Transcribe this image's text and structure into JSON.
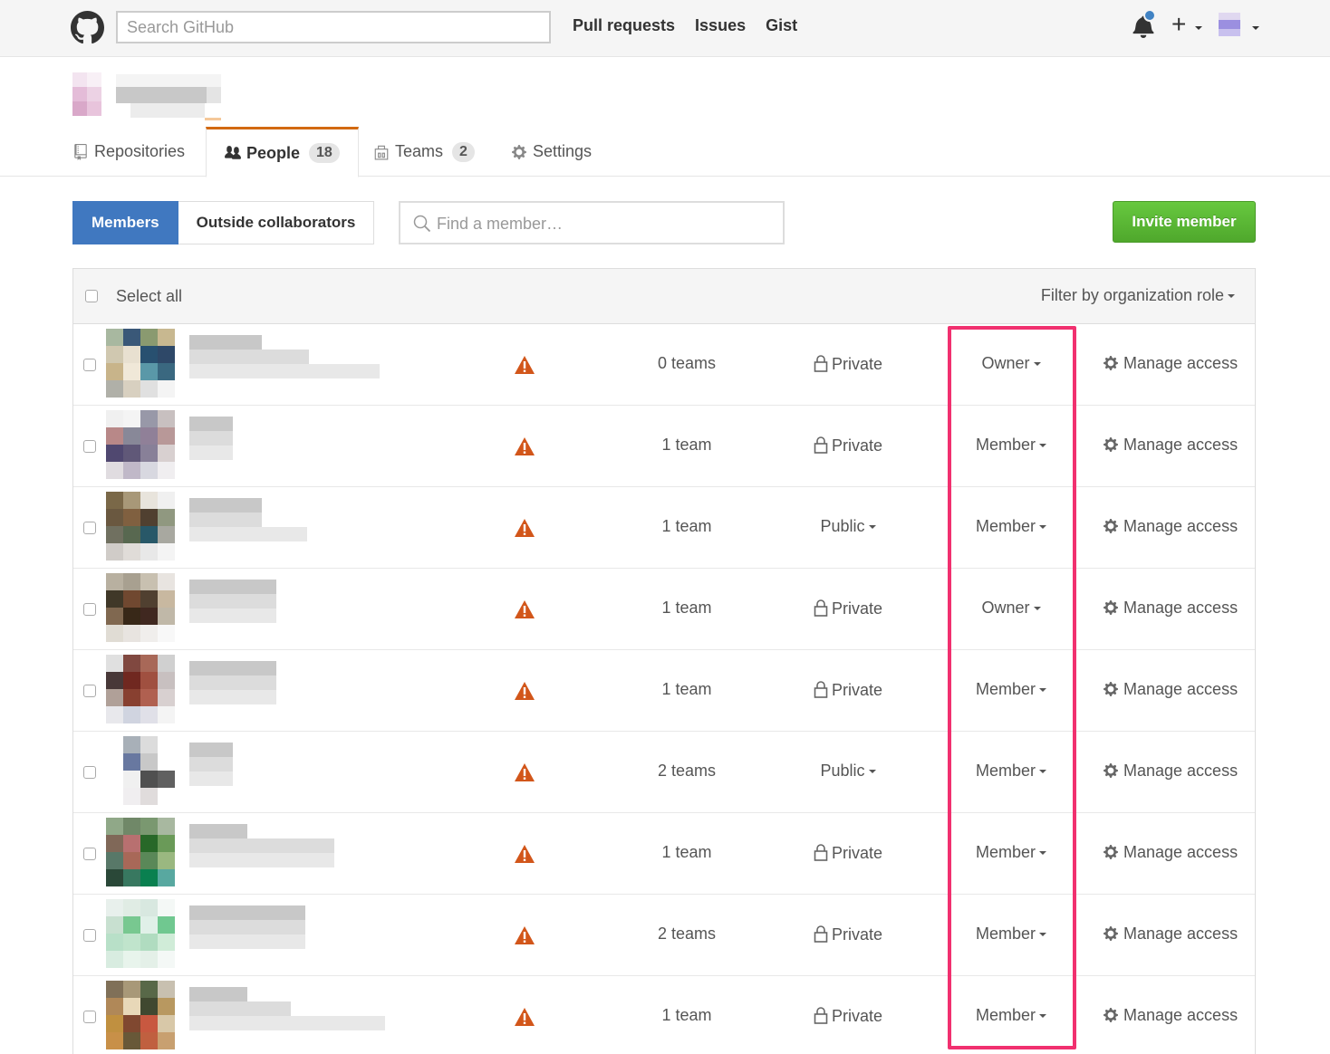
{
  "header": {
    "search_placeholder": "Search GitHub",
    "nav": [
      "Pull requests",
      "Issues",
      "Gist"
    ],
    "plus_label": "+"
  },
  "tabs": [
    {
      "label": "Repositories",
      "count": null,
      "icon": "repo-icon"
    },
    {
      "label": "People",
      "count": "18",
      "icon": "people-icon",
      "selected": true
    },
    {
      "label": "Teams",
      "count": "2",
      "icon": "team-icon"
    },
    {
      "label": "Settings",
      "count": null,
      "icon": "gear-icon"
    }
  ],
  "subnav": {
    "members": "Members",
    "outside": "Outside collaborators",
    "find_placeholder": "Find a member…",
    "invite": "Invite member"
  },
  "table": {
    "select_all": "Select all",
    "filter": "Filter by organization role",
    "manage_label": "Manage access",
    "rows": [
      {
        "teams": "0 teams",
        "visibility": "Private",
        "role": "Owner"
      },
      {
        "teams": "1 team",
        "visibility": "Private",
        "role": "Member"
      },
      {
        "teams": "1 team",
        "visibility": "Public",
        "role": "Member"
      },
      {
        "teams": "1 team",
        "visibility": "Private",
        "role": "Owner"
      },
      {
        "teams": "1 team",
        "visibility": "Private",
        "role": "Member"
      },
      {
        "teams": "2 teams",
        "visibility": "Public",
        "role": "Member"
      },
      {
        "teams": "1 team",
        "visibility": "Private",
        "role": "Member"
      },
      {
        "teams": "2 teams",
        "visibility": "Private",
        "role": "Member"
      },
      {
        "teams": "1 team",
        "visibility": "Private",
        "role": "Member"
      }
    ]
  },
  "colors": {
    "accent_blue": "#4078c0",
    "invite_green": "#5cb539",
    "tab_orange": "#d26911",
    "warning_orange": "#d2561a",
    "highlight_pink": "#f1306f"
  }
}
